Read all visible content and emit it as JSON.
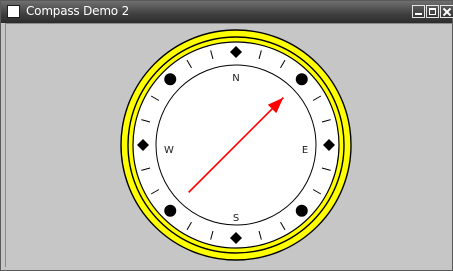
{
  "window": {
    "title": "Compass Demo 2"
  },
  "compass": {
    "heading_degrees": 45,
    "labels": {
      "north": "N",
      "east": "E",
      "south": "S",
      "west": "W"
    },
    "colors": {
      "bezel": "#ffff00",
      "face": "#ffffff",
      "needle": "#ff0000",
      "background": "#c6c6c6"
    }
  }
}
